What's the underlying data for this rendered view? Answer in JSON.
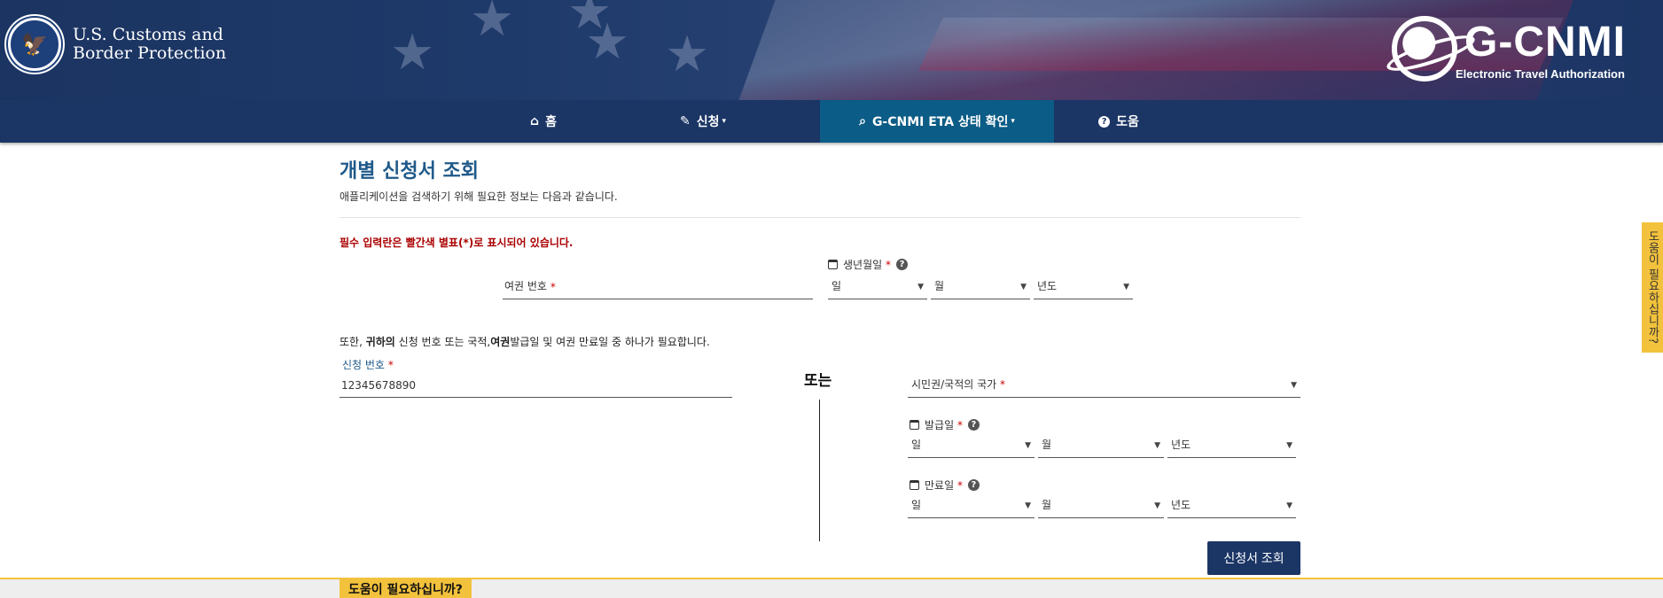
{
  "header": {
    "agency_line1": "U.S. Customs and",
    "agency_line2": "Border Protection",
    "product_title": "G-CNMI",
    "product_subtitle": "Electronic Travel Authorization"
  },
  "nav": {
    "items": [
      {
        "label": "홈",
        "icon": "home-icon"
      },
      {
        "label": "신청",
        "icon": "pencil-icon"
      },
      {
        "label": "G-CNMI ETA 상태 확인",
        "icon": "search-icon"
      },
      {
        "label": "도움",
        "icon": "question-circle-icon"
      }
    ]
  },
  "page": {
    "title": "개별 신청서 조회",
    "description": "애플리케이션을 검색하기 위해 필요한 정보는 다음과 같습니다.",
    "required_note": "필수 입력란은 빨간색 별표(*)로 표시되어 있습니다."
  },
  "form": {
    "passport_label": "여권 번호",
    "dob_label": "생년월일",
    "dob": {
      "day": "일",
      "month": "월",
      "year": "년도"
    },
    "also_prefix": "또한, ",
    "also_bold1": "귀하의",
    "also_mid": " 신청 번호 또는 국적,",
    "also_bold2": "여권",
    "also_suffix": "발급일 및 여권 만료일 중 하나가 필요합니다.",
    "app_number_label": "신청 번호",
    "app_number_value": "12345678890",
    "or_label": "또는",
    "citizenship_label": "시민권/국적의 국가",
    "issue_label": "발급일",
    "issue": {
      "day": "일",
      "month": "월",
      "year": "년도"
    },
    "expiry_label": "만료일",
    "expiry": {
      "day": "일",
      "month": "월",
      "year": "년도"
    },
    "required_mark": "*",
    "submit_label": "신청서 조회"
  },
  "help": {
    "footer_tab": "도움이 필요하십니까?",
    "side_tab": "도움이 필요하십니까?"
  },
  "colors": {
    "navy": "#1b3565",
    "active_tab": "#0b5c86",
    "accent_yellow": "#f3c23c",
    "title_blue": "#205a8a",
    "required_red": "#a00000"
  }
}
